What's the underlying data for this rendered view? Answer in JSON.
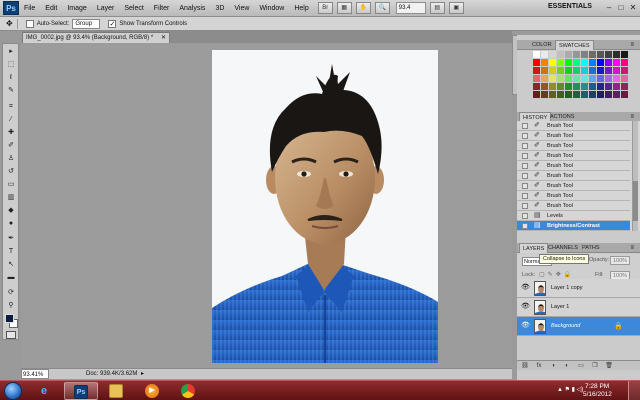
{
  "app": {
    "logo": "Ps",
    "menus": [
      "File",
      "Edit",
      "Image",
      "Layer",
      "Select",
      "Filter",
      "Analysis",
      "3D",
      "View",
      "Window",
      "Help"
    ],
    "zoom": "93.4",
    "workspace": "ESSENTIALS"
  },
  "options": {
    "auto_select_label": "Auto-Select:",
    "auto_select_value": "Group",
    "show_transform_label": "Show Transform Controls"
  },
  "document": {
    "tab_title": "IMG_0002.jpg @ 93.4% (Background, RGB/8) *",
    "status_zoom": "93.41%",
    "doc_info": "Doc: 939.4K/3.62M"
  },
  "panels": {
    "color_tab": "COLOR",
    "swatches_tab": "SWATCHES",
    "history_tab": "HISTORY",
    "actions_tab": "ACTIONS",
    "history_items": [
      "Brush Tool",
      "Brush Tool",
      "Brush Tool",
      "Brush Tool",
      "Brush Tool",
      "Brush Tool",
      "Brush Tool",
      "Brush Tool",
      "Brush Tool",
      "Levels",
      "Brightness/Contrast"
    ],
    "layers_tab": "LAYERS",
    "channels_tab": "CHANNELS",
    "paths_tab": "PATHS",
    "blend_mode": "Normal",
    "tooltip": "Collapse to Icons",
    "opacity_label": "Opacity:",
    "opacity_value": "100%",
    "lock_label": "Lock:",
    "fill_label": "Fill:",
    "fill_value": "100%",
    "layers": [
      "Layer 1 copy",
      "Layer 1",
      "Background"
    ]
  },
  "taskbar": {
    "time": "7:28 PM",
    "date": "5/16/2012"
  },
  "colors": {
    "selection_blue": "#3c89dc",
    "taskbar_red": "#7a1e20",
    "shirt_blue": "#1f5fc4"
  }
}
